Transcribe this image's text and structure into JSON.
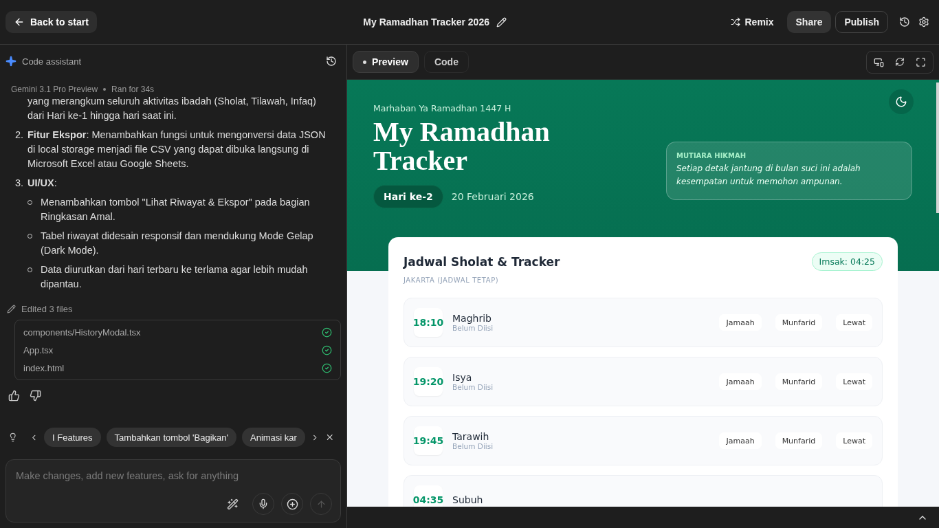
{
  "topbar": {
    "back_button": "Back to start",
    "title": "My Ramadhan Tracker 2026",
    "actions": [
      {
        "kind": "remix",
        "label": "Remix"
      },
      {
        "kind": "share",
        "label": "Share"
      },
      {
        "kind": "publish",
        "label": "Publish"
      }
    ]
  },
  "assistant": {
    "title": "Code assistant",
    "model": "Gemini 3.1 Pro Preview",
    "run_time": "Ran for 34s",
    "intro_continued": "yang merangkum seluruh aktivitas ibadah (Sholat, Tilawah, Infaq) dari Hari ke-1 hingga hari saat ini.",
    "points": [
      {
        "number": "2.",
        "text": "**Fitur Ekspor**: Menambahkan fungsi untuk mengonversi data JSON di local storage menjadi file CSV yang dapat dibuka langsung di Microsoft Excel atau Google Sheets."
      },
      {
        "number": "3.",
        "text": "**UI/UX**:",
        "bullets": [
          "Menambahkan tombol \"Lihat Riwayat & Ekspor\" pada bagian Ringkasan Amal.",
          "Tabel riwayat didesain responsif dan mendukung Mode Gelap (Dark Mode).",
          "Data diurutkan dari hari terbaru ke terlama agar lebih mudah dipantau."
        ]
      }
    ],
    "edited_label": "Edited 3 files",
    "files": [
      {
        "name": "components/HistoryModal.tsx",
        "done": true
      },
      {
        "name": "App.tsx",
        "done": true
      },
      {
        "name": "index.html",
        "done": true
      }
    ],
    "suggestions": [
      "I Features",
      "Tambahkan tombol 'Bagikan'",
      "Animasi kar"
    ],
    "input": {
      "placeholder": "Make changes, add new features, ask for anything"
    }
  },
  "preview": {
    "tabs": [
      {
        "label": "Preview",
        "selected": true
      },
      {
        "label": "Code",
        "selected": false
      }
    ],
    "app": {
      "greeting": "Marhaban Ya Ramadhan 1447 H",
      "title": "My Ramadhan Tracker",
      "day": "Hari ke-2",
      "date": "20 Februari 2026",
      "quote": {
        "heading": "MUTIARA HIKMAH",
        "text": "Setiap detak jantung di bulan suci ini adalah kesempatan untuk memohon ampunan."
      },
      "schedule": {
        "title": "Jadwal Sholat & Tracker",
        "imsak": "Imsak: 04:25",
        "location": "JAKARTA (JADWAL TETAP)",
        "prayers": [
          {
            "time": "18:10",
            "name": "Maghrib",
            "status": "Belum Diisi",
            "choices": [
              {
                "label": "Jamaah",
                "selected": false
              },
              {
                "label": "Munfarid",
                "selected": false
              },
              {
                "label": "Lewat",
                "selected": false
              }
            ]
          },
          {
            "time": "19:20",
            "name": "Isya",
            "status": "Belum Diisi",
            "choices": [
              {
                "label": "Jamaah",
                "selected": false
              },
              {
                "label": "Munfarid",
                "selected": false
              },
              {
                "label": "Lewat",
                "selected": false
              }
            ]
          },
          {
            "time": "19:45",
            "name": "Tarawih",
            "status": "Belum Diisi",
            "choices": [
              {
                "label": "Jamaah",
                "selected": false
              },
              {
                "label": "Munfarid",
                "selected": false
              },
              {
                "label": "Lewat",
                "selected": false
              }
            ]
          },
          {
            "time": "04:35",
            "name": "Subuh"
          }
        ]
      }
    }
  }
}
